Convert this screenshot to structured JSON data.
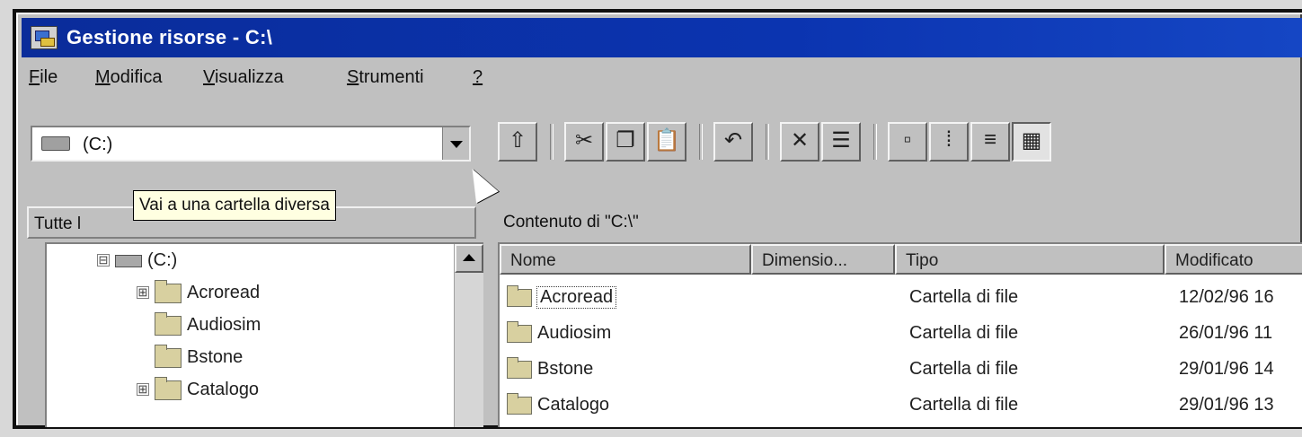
{
  "window": {
    "title": "Gestione risorse - C:\\",
    "icon": "explorer-icon"
  },
  "menubar": {
    "items": [
      {
        "label": "File",
        "accel": "F"
      },
      {
        "label": "Modifica",
        "accel": "M"
      },
      {
        "label": "Visualizza",
        "accel": "V"
      },
      {
        "label": "Strumenti",
        "accel": "S"
      },
      {
        "label": "?",
        "accel": "?"
      }
    ]
  },
  "address": {
    "value": "(C:)",
    "icon": "drive-icon"
  },
  "toolbar": {
    "buttons": [
      {
        "name": "up-folder-icon",
        "glyph": "⇧"
      },
      {
        "name": "cut-icon",
        "glyph": "✂"
      },
      {
        "name": "copy-icon",
        "glyph": "❐"
      },
      {
        "name": "paste-icon",
        "glyph": "📋"
      },
      {
        "name": "undo-icon",
        "glyph": "↶"
      },
      {
        "name": "delete-icon",
        "glyph": "✕"
      },
      {
        "name": "properties-icon",
        "glyph": "☰"
      },
      {
        "name": "large-icons-icon",
        "glyph": "▫"
      },
      {
        "name": "small-icons-icon",
        "glyph": "⁞"
      },
      {
        "name": "list-icon",
        "glyph": "≡"
      },
      {
        "name": "details-icon",
        "glyph": "▦"
      }
    ]
  },
  "left_pane": {
    "header": "Tutte l"
  },
  "tooltip": {
    "text": "Vai a una cartella diversa"
  },
  "right_pane": {
    "header": "Contenuto di \"C:\\\""
  },
  "tree": {
    "items": [
      {
        "label": "(C:)",
        "type": "drive",
        "expander": "⊟"
      },
      {
        "label": "Acroread",
        "type": "folder",
        "expander": "⊞"
      },
      {
        "label": "Audiosim",
        "type": "folder",
        "expander": ""
      },
      {
        "label": "Bstone",
        "type": "folder",
        "expander": ""
      },
      {
        "label": "Catalogo",
        "type": "folder",
        "expander": "⊞"
      }
    ]
  },
  "list": {
    "columns": [
      "Nome",
      "Dimensio...",
      "Tipo",
      "Modificato"
    ],
    "rows": [
      {
        "name": "Acroread",
        "size": "",
        "type": "Cartella di file",
        "modified": "12/02/96 16"
      },
      {
        "name": "Audiosim",
        "size": "",
        "type": "Cartella di file",
        "modified": "26/01/96 11"
      },
      {
        "name": "Bstone",
        "size": "",
        "type": "Cartella di file",
        "modified": "29/01/96 14"
      },
      {
        "name": "Catalogo",
        "size": "",
        "type": "Cartella di file",
        "modified": "29/01/96 13"
      }
    ]
  },
  "colors": {
    "titlebar": "#0b34b0",
    "face": "#c0c0c0",
    "tooltip_bg": "#ffffe1"
  }
}
